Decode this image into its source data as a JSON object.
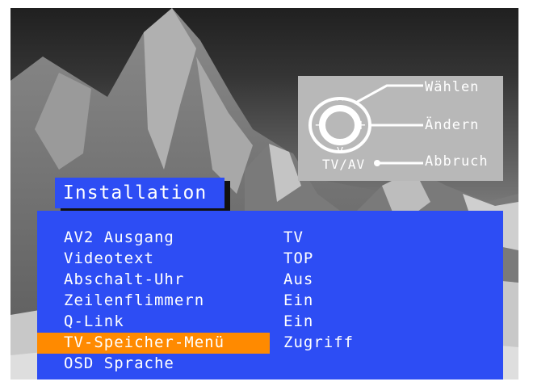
{
  "title": "Installation",
  "help": {
    "select": "Wählen",
    "change": "Ändern",
    "cancel": "Abbruch",
    "tvav": "TV/AV",
    "up_symbol": "^",
    "down_symbol": "v",
    "minus_symbol": "−",
    "plus_symbol": "+"
  },
  "menu": {
    "items": [
      {
        "label": "AV2 Ausgang",
        "value": "TV"
      },
      {
        "label": "Videotext",
        "value": "TOP"
      },
      {
        "label": "Abschalt-Uhr",
        "value": "Aus"
      },
      {
        "label": "Zeilenflimmern",
        "value": "Ein"
      },
      {
        "label": "Q-Link",
        "value": "Ein"
      },
      {
        "label": "TV-Speicher-Menü",
        "value": "Zugriff"
      },
      {
        "label": "OSD Sprache",
        "value": ""
      }
    ],
    "selected_index": 5
  },
  "colors": {
    "menu_blue": "#2d4df4",
    "highlight_orange": "#ff8a00",
    "panel_gray": "#b8b8b8"
  }
}
